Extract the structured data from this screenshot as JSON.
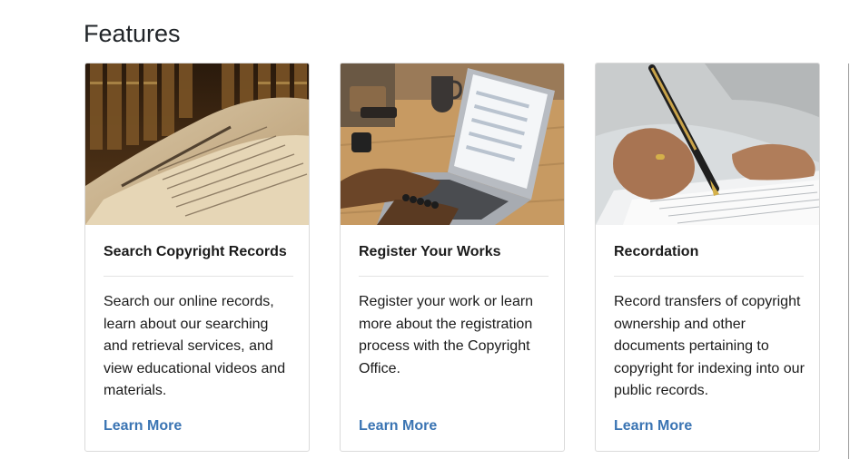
{
  "section": {
    "title": "Features"
  },
  "cards": [
    {
      "image_icon": "book-photo",
      "title": "Search Copyright Records",
      "text": "Search our online records, learn about our searching and retrieval services, and view educational videos and materials.",
      "link": "Learn More"
    },
    {
      "image_icon": "laptop-photo",
      "title": "Register Your Works",
      "text": "Register your work or learn more about the registration process with the Copyright Office.",
      "link": "Learn More"
    },
    {
      "image_icon": "signing-document-photo",
      "title": "Recordation",
      "text": "Record transfers of copyright ownership and other documents pertaining to copyright for indexing into our public records.",
      "link": "Learn More"
    }
  ],
  "colors": {
    "link": "#3a74b3",
    "heading": "#212529",
    "border": "#dadada"
  }
}
